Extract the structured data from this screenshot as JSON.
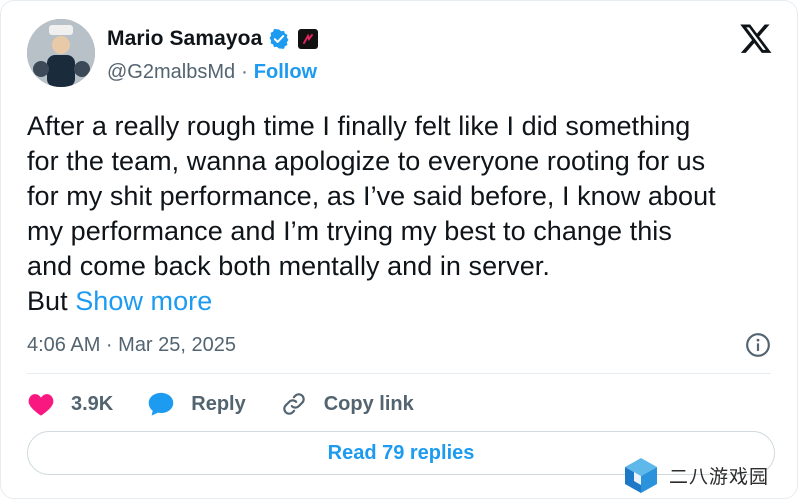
{
  "tweet": {
    "author": {
      "name": "Mario Samayoa",
      "handle": "@G2malbsMd",
      "separator": "·",
      "follow_label": "Follow"
    },
    "text_lines": [
      "After a really rough time I finally felt like I did something",
      "for the team, wanna apologize to everyone rooting for us",
      "for my shit performance, as I’ve said before, I know about",
      "my performance and I’m trying my best to change this",
      "and come back both mentally and in server."
    ],
    "truncated_text": "But",
    "show_more_label": "Show more",
    "timestamp": "4:06 AM · Mar 25, 2025",
    "actions": {
      "like_count": "3.9K",
      "reply_label": "Reply",
      "copy_link_label": "Copy link"
    },
    "read_replies_label": "Read 79 replies"
  },
  "watermark": {
    "text": "二八游戏园"
  },
  "colors": {
    "accent": "#1d9bf0",
    "like": "#f91880",
    "text": "#0f1419",
    "muted": "#536471",
    "border": "#cfd9de"
  },
  "icons": [
    "verified-badge-icon",
    "affiliate-badge-icon",
    "x-logo-icon",
    "info-icon",
    "heart-icon",
    "reply-bubble-icon",
    "link-icon",
    "watermark-cube-icon"
  ]
}
